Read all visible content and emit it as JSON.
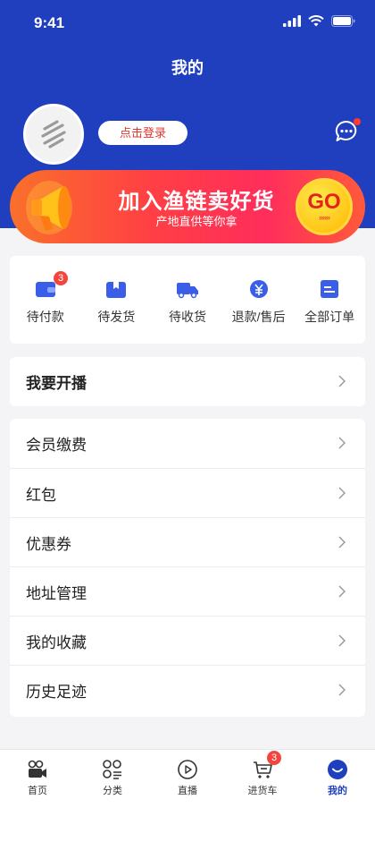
{
  "status_bar": {
    "time": "9:41"
  },
  "header": {
    "title": "我的",
    "login_label": "点击登录"
  },
  "banner": {
    "title": "加入渔链卖好货",
    "subtitle": "产地直供等你拿",
    "go_label": "GO",
    "go_arrows": "»»»"
  },
  "orders": [
    {
      "label": "待付款",
      "icon": "wallet-icon",
      "badge": "3"
    },
    {
      "label": "待发货",
      "icon": "package-icon"
    },
    {
      "label": "待收货",
      "icon": "truck-icon"
    },
    {
      "label": "退款/售后",
      "icon": "refund-icon"
    },
    {
      "label": "全部订单",
      "icon": "order-list-icon"
    }
  ],
  "live": {
    "label": "我要开播"
  },
  "menu": [
    {
      "label": "会员缴费"
    },
    {
      "label": "红包"
    },
    {
      "label": "优惠券"
    },
    {
      "label": "地址管理"
    },
    {
      "label": "我的收藏"
    },
    {
      "label": "历史足迹"
    }
  ],
  "tabbar": [
    {
      "label": "首页",
      "icon": "home-camera-icon"
    },
    {
      "label": "分类",
      "icon": "category-icon"
    },
    {
      "label": "直播",
      "icon": "live-play-icon"
    },
    {
      "label": "进货车",
      "icon": "cart-icon",
      "badge": "3"
    },
    {
      "label": "我的",
      "icon": "profile-icon",
      "active": true
    }
  ],
  "colors": {
    "primary": "#1f3fbf",
    "accent_red": "#e6352b",
    "badge": "#f2453d"
  }
}
